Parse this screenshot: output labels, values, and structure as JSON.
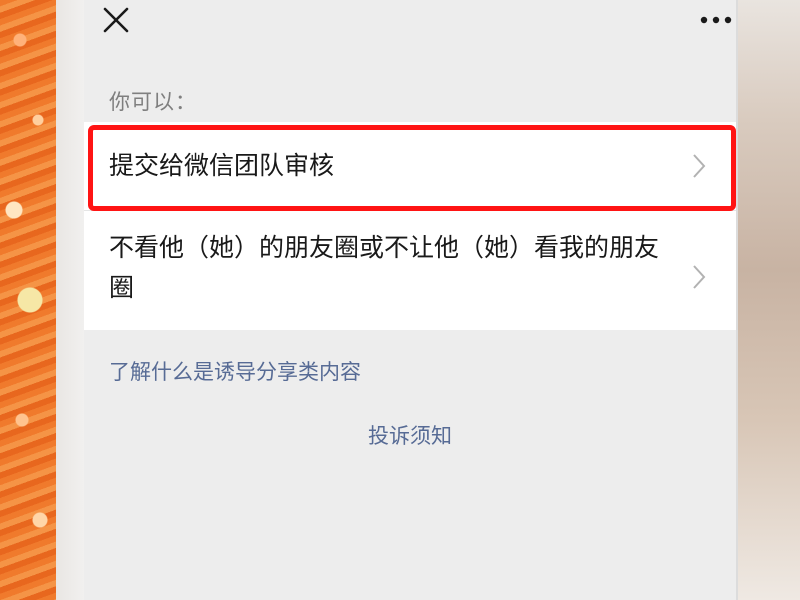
{
  "top_bar": {
    "close_icon": "close-icon",
    "more_icon": "more-dots-icon"
  },
  "hint_text": "你可以：",
  "options": [
    {
      "label": "提交给微信团队审核",
      "highlighted": true
    },
    {
      "label": "不看他（她）的朋友圈或不让他（她）看我的朋友圈",
      "highlighted": false
    }
  ],
  "links": {
    "learn_more": "了解什么是诱导分享类内容",
    "complaint_notice": "投诉须知"
  },
  "colors": {
    "panel_bg": "#ededed",
    "list_bg": "#ffffff",
    "link": "#576b95",
    "highlight_border": "#ff1414",
    "hint": "#7f7f7f",
    "text": "#191919"
  }
}
